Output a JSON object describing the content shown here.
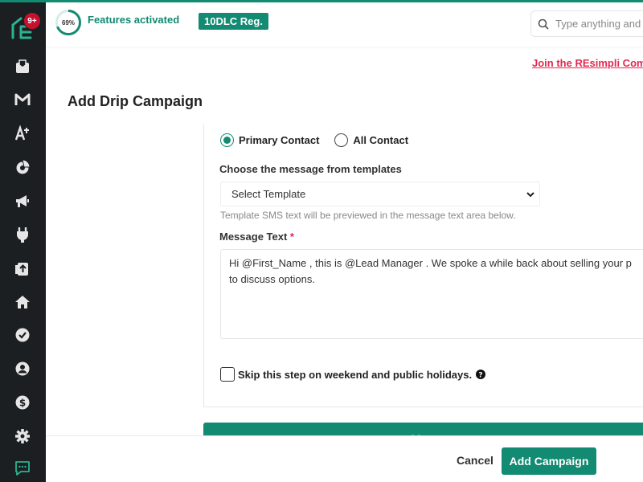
{
  "sidebar": {
    "notification_badge": "9+",
    "items": [
      {
        "icon": "inbox-icon"
      },
      {
        "icon": "mail-icon"
      },
      {
        "icon": "ai-icon"
      },
      {
        "icon": "analytics-icon"
      },
      {
        "icon": "megaphone-icon"
      },
      {
        "icon": "plug-icon"
      },
      {
        "icon": "upload-icon"
      },
      {
        "icon": "home-icon"
      },
      {
        "icon": "check-circle-icon"
      },
      {
        "icon": "user-icon"
      },
      {
        "icon": "dollar-icon"
      },
      {
        "icon": "gear-icon"
      },
      {
        "icon": "chat-icon"
      }
    ]
  },
  "topbar": {
    "progress_percent": "69%",
    "progress_value": 69,
    "features_label": "Features activated",
    "dlc_badge": "10DLC Reg.",
    "search_placeholder": "Type anything and"
  },
  "community_link": "Join the REsimpli Com",
  "page_title": "Add Drip Campaign",
  "form": {
    "radios": [
      {
        "label": "Primary Contact",
        "checked": true
      },
      {
        "label": "All Contact",
        "checked": false
      }
    ],
    "template_label": "Choose the message from templates",
    "template_selected": "Select Template",
    "template_hint": "Template SMS text will be previewed in the message text area below.",
    "message_label": "Message Text",
    "required_mark": "*",
    "message_text": "Hi @First_Name , this is @Lead Manager . We spoke a while back about selling your p to discuss options.",
    "skip_label": "Skip this step on weekend and public holidays.",
    "add_step_label": "Add Step"
  },
  "footer": {
    "cancel_label": "Cancel",
    "add_campaign_label": "Add Campaign"
  },
  "colors": {
    "accent": "#138a72",
    "sidebar_bg": "#1b1f22",
    "badge_red": "#c8102e",
    "link_red": "#e02950"
  }
}
